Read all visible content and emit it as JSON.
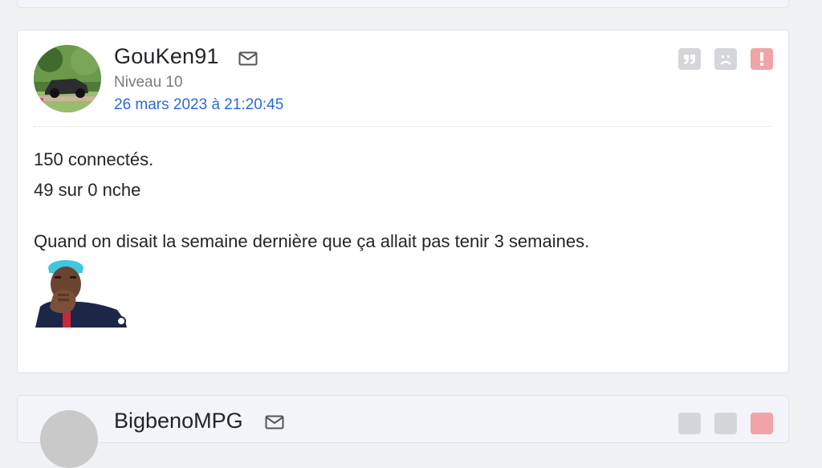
{
  "post": {
    "username": "GouKen91",
    "level": "Niveau 10",
    "date": "26 mars 2023 à 21:20:45",
    "lines": [
      "150 connectés.",
      "49 sur 0 nche",
      "Quand on disait la semaine dernière que ça allait pas tenir 3 semaines."
    ]
  },
  "next_post": {
    "username": "BigbenoMPG"
  },
  "icons": {
    "mail": "mail-icon",
    "quote": "quote-icon",
    "sad": "sad-face-icon",
    "alert": "exclamation-icon"
  },
  "colors": {
    "date": "#2a6bd1",
    "alert_button": "#f0a4a8",
    "neutral_button": "#d4d6da"
  }
}
